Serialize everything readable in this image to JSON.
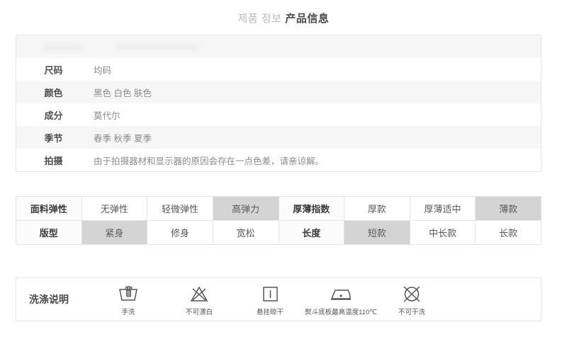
{
  "header": {
    "title_kr": "제품 정보",
    "title_cn": "产品信息"
  },
  "info_table": {
    "redacted_row": {
      "key_placeholder": "",
      "value_placeholder": ""
    },
    "rows": [
      {
        "key": "尺码",
        "value": "均码"
      },
      {
        "key": "颜色",
        "value": "黑色 白色 肤色"
      },
      {
        "key": "成分",
        "value": "莫代尔"
      },
      {
        "key": "季节",
        "value": "春季 秋季 夏季"
      },
      {
        "key": "拍摄",
        "value": "由于拍摄器材和显示器的原因会存在一点色差，请亲谅解。"
      }
    ]
  },
  "spec_table": {
    "rows": [
      {
        "cells": [
          {
            "text": "面料弹性",
            "type": "header"
          },
          {
            "text": "无弹性",
            "type": "option"
          },
          {
            "text": "轻微弹性",
            "type": "option"
          },
          {
            "text": "高弹力",
            "type": "selected"
          },
          {
            "text": "厚薄指数",
            "type": "header"
          },
          {
            "text": "厚款",
            "type": "option"
          },
          {
            "text": "厚薄适中",
            "type": "option"
          },
          {
            "text": "薄款",
            "type": "selected"
          }
        ]
      },
      {
        "cells": [
          {
            "text": "版型",
            "type": "header"
          },
          {
            "text": "紧身",
            "type": "selected"
          },
          {
            "text": "修身",
            "type": "option"
          },
          {
            "text": "宽松",
            "type": "option"
          },
          {
            "text": "长度",
            "type": "header"
          },
          {
            "text": "短款",
            "type": "selected"
          },
          {
            "text": "中长款",
            "type": "option"
          },
          {
            "text": "长款",
            "type": "option"
          }
        ]
      }
    ]
  },
  "wash_care": {
    "label": "洗涤说明",
    "items": [
      {
        "icon": "hand-wash-icon",
        "caption": "手洗"
      },
      {
        "icon": "do-not-bleach-icon",
        "caption": "不可漂白"
      },
      {
        "icon": "line-dry-icon",
        "caption": "悬挂晾干"
      },
      {
        "icon": "iron-low-temp-icon",
        "caption": "熨斗底板最高温度110℃"
      },
      {
        "icon": "do-not-dry-clean-icon",
        "caption": "不可干洗"
      }
    ]
  },
  "colors": {
    "selected_cell": "#d4d4d4",
    "border": "#e4e4e4",
    "alt_row": "#f6f6f6",
    "title_muted": "#b9b9b9",
    "title_strong": "#4a4a4a"
  }
}
